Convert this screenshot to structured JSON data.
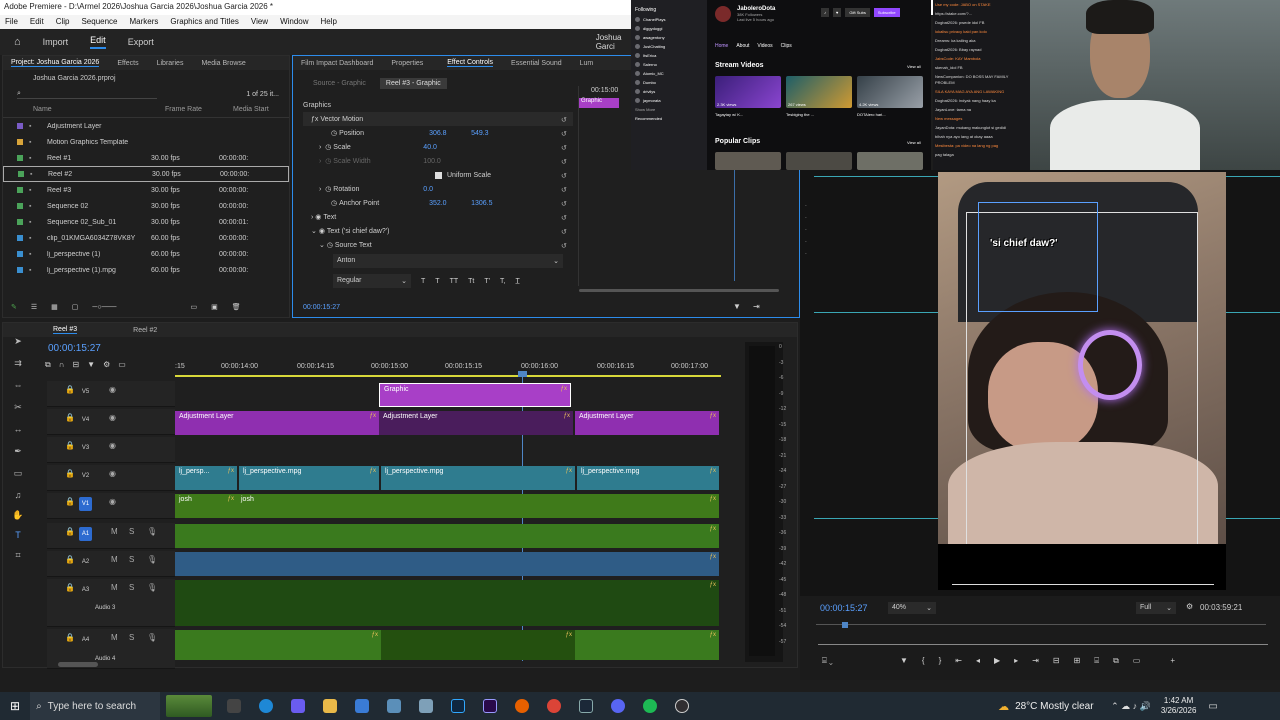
{
  "window": {
    "title": "Adobe Premiere - D:\\Armel 2026\\Joshua Garcia 2026\\Joshua Garcia 2026 *"
  },
  "menu": [
    "File",
    "Edit",
    "Clip",
    "Sequence",
    "Markers",
    "Graphics and Titles",
    "View",
    "Window",
    "Help"
  ],
  "appbar": {
    "home": "home-icon",
    "import": "Import",
    "edit": "Edit",
    "export": "Export",
    "project_title": "Joshua Garci"
  },
  "project_panel": {
    "tabs": [
      "Project: Joshua Garcia 2026",
      "Effects",
      "Libraries",
      "Media Browse"
    ],
    "file": "Joshua Garcia 2026.prproj",
    "count": "1 of 25 it...",
    "columns": [
      "Name",
      "Frame Rate",
      "Media Start"
    ],
    "items": [
      {
        "name": "Adjustment Layer",
        "fps": "",
        "start": "",
        "color": "#7a5cc6"
      },
      {
        "name": "Motion Graphics Template",
        "fps": "",
        "start": "",
        "color": "#d8a43a"
      },
      {
        "name": "Reel #1",
        "fps": "30.00 fps",
        "start": "00:00:00:",
        "color": "#4ba35a"
      },
      {
        "name": "Reel #2",
        "fps": "30.00 fps",
        "start": "00:00:00:",
        "color": "#4ba35a"
      },
      {
        "name": "Reel #3",
        "fps": "30.00 fps",
        "start": "00:00:00:",
        "color": "#4ba35a"
      },
      {
        "name": "Sequence 02",
        "fps": "30.00 fps",
        "start": "00:00:00:",
        "color": "#4ba35a"
      },
      {
        "name": "Sequence 02_Sub_01",
        "fps": "30.00 fps",
        "start": "00:00:01:",
        "color": "#4ba35a"
      },
      {
        "name": "clip_01KMGA6034Z78VK8Y",
        "fps": "60.00 fps",
        "start": "00:00:00:",
        "color": "#3a8fd0"
      },
      {
        "name": "lj_perspective (1)",
        "fps": "60.00 fps",
        "start": "00:00:00:",
        "color": "#3a8fd0"
      },
      {
        "name": "lj_perspective (1).mpg",
        "fps": "60.00 fps",
        "start": "00:00:00:",
        "color": "#3a8fd0"
      }
    ]
  },
  "effect_controls": {
    "tabs": [
      "Film Impact Dashboard",
      "Properties",
      "Effect Controls",
      "Essential Sound",
      "Lum"
    ],
    "source": "Source - Graphic",
    "target": "Reel #3 - Graphic",
    "mini_time": "00:15:00",
    "mini_clip": "Graphic",
    "section": "Graphics",
    "vector": "Vector Motion",
    "position_label": "Position",
    "position_x": "306.8",
    "position_y": "549.3",
    "scale_label": "Scale",
    "scale": "40.0",
    "scale_width_label": "Scale Width",
    "scale_width": "100.0",
    "uniform": "Uniform Scale",
    "rotation_label": "Rotation",
    "rotation": "0.0",
    "anchor_label": "Anchor Point",
    "anchor_x": "352.0",
    "anchor_y": "1306.5",
    "text_label": "Text",
    "text_layer": "Text ('si chief daw?')",
    "source_text": "Source Text",
    "font": "Anton",
    "style": "Regular",
    "timecode": "00:00:15:27"
  },
  "timeline": {
    "tabs": [
      "Reel #3",
      "Reel #2"
    ],
    "timecode": "00:00:15:27",
    "ruler": [
      ":15",
      "00:00:14:00",
      "00:00:14:15",
      "00:00:15:00",
      "00:00:15:15",
      "00:00:16:00",
      "00:00:16:15",
      "00:00:17:00"
    ],
    "tracks": [
      "V5",
      "V4",
      "V3",
      "V2",
      "V1",
      "A1",
      "A2",
      "A3",
      "A4"
    ],
    "audio3": "Audio 3",
    "audio4": "Audio 4",
    "clips": {
      "graphic": "Graphic",
      "adj": "Adjustment Layer",
      "persp_short": "lj_persp...",
      "persp": "lj_perspective.mpg",
      "josh": "josh"
    },
    "meter": [
      "0",
      "-3",
      "-6",
      "-9",
      "-12",
      "-15",
      "-18",
      "-21",
      "-24",
      "-27",
      "-30",
      "-33",
      "-36",
      "-39",
      "-42",
      "-45",
      "-48",
      "-51",
      "-54",
      "-57"
    ]
  },
  "program": {
    "timecode": "00:00:15:27",
    "zoom": "40%",
    "quality": "Full",
    "duration": "00:03:59:21",
    "overlay_text": "'si chief daw?'"
  },
  "twitch": {
    "following": "Following",
    "follows": [
      "ChanelPlays",
      "diggydoggi",
      "awagentony",
      "JustChatting",
      "ItsErica",
      "Salerno",
      "Atomic_MC",
      "Dumbo",
      "drivilys",
      "jaymorata"
    ],
    "channel": "JaboleroDota",
    "followers": "38K Followers",
    "live": "Last live 5 hours ago",
    "nav": [
      "Home",
      "About",
      "Videos",
      "Clips"
    ],
    "stream_videos": "Stream Videos",
    "view_all": "View all",
    "clips": [
      {
        "title": "Tagaytay w/ K...",
        "meta": "2.3K views"
      },
      {
        "title": "Tesbiging the ...",
        "meta": "267 views"
      },
      {
        "title": "DOTAlero hari...",
        "meta": "4.2K views"
      }
    ],
    "popular": "Popular Clips",
    "btn_gift": "Gift Subs",
    "btn_sub": "Subscribe",
    "side": [
      "Show More",
      "Recommended"
    ]
  },
  "chat": [
    "Use my code: JABO on STAKE",
    "https://stake.com/?...",
    "Dogbat2026: pwede idol FB",
    "lokalisu privacy kaid pan kolo",
    "Dreams: ka kailing aka",
    "Dogbat2026: Bbay raynad",
    "JabsCode: KAY Mambola",
    "skenah_idol FB",
    "NewCompanion: DO BOSS MAY FAMILY PROBLEM",
    "SILA KAYA MAG AYA ANG LAWAKING",
    "Dogbat2026: indyak nang haay ka",
    "JayanLove: tama na",
    "New messages",
    "JayanDota: mukang makunglot si gedidi",
    "bihah nya ayo lang at okay aaaa",
    "Mesibesta: pa video na lang ng pag",
    "pag talaga"
  ],
  "taskbar": {
    "search": "Type here to search",
    "weather": "28°C  Mostly clear",
    "time": "1:42 AM",
    "date": "3/26/2026"
  },
  "colors": {
    "accent": "#2d8ceb",
    "graphic_clip": "#a83fc7",
    "adjustment": "#8f2fb0",
    "video_clip": "#2f7c8f",
    "audio_clip": "#3a7a1e",
    "twitch_purple": "#9147ff"
  }
}
